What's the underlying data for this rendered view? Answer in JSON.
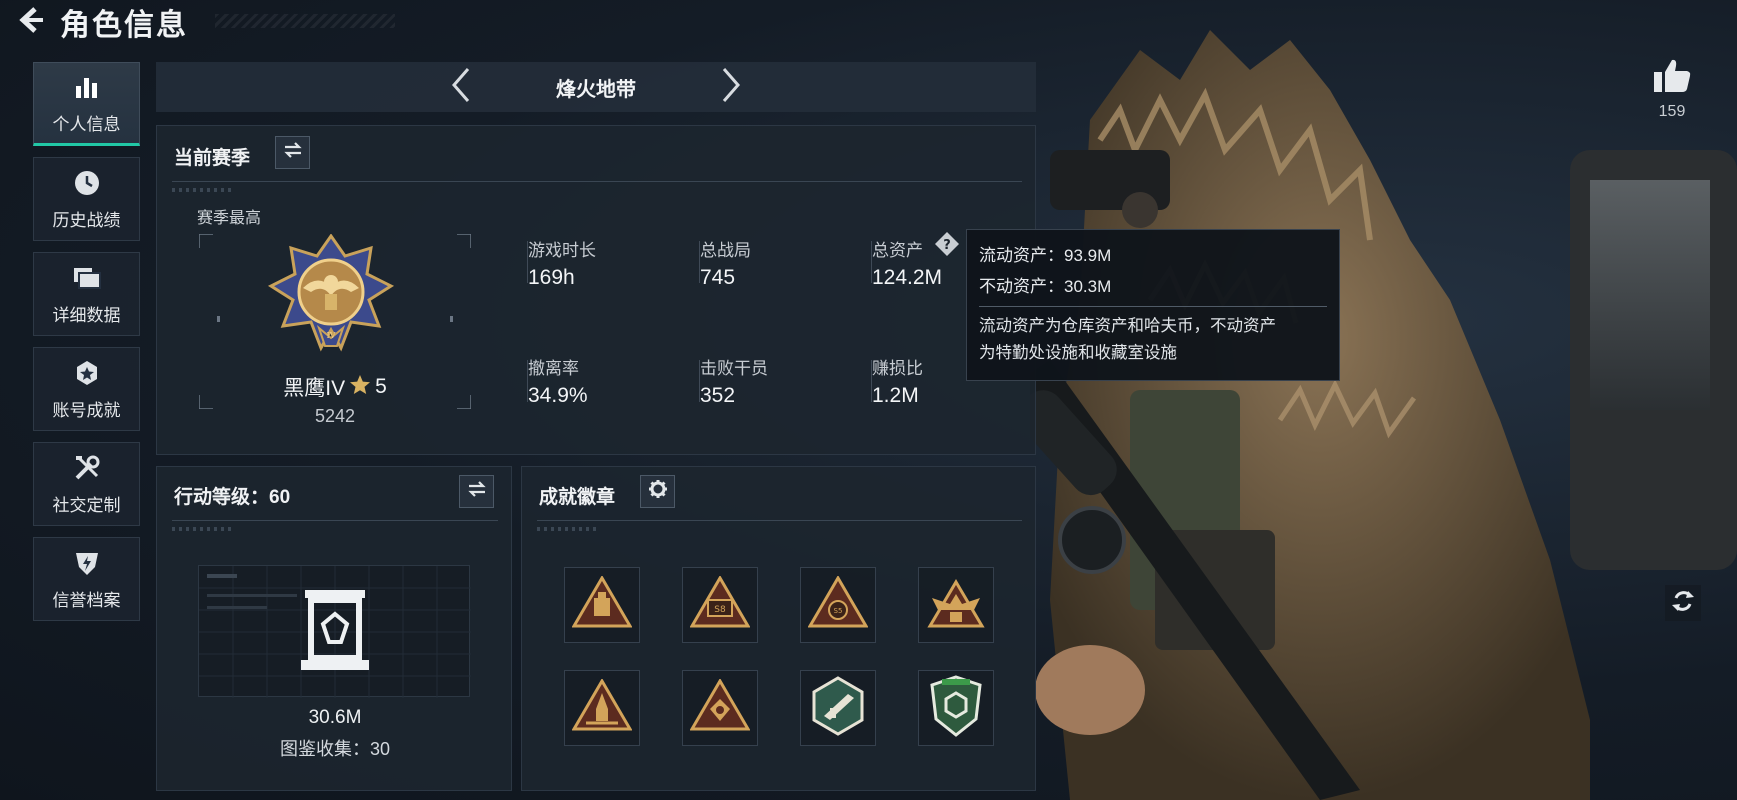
{
  "header": {
    "title": "角色信息"
  },
  "nav": {
    "items": [
      {
        "label": "个人信息",
        "icon": "bar-chart-icon",
        "active": true
      },
      {
        "label": "历史战绩",
        "icon": "clock-icon"
      },
      {
        "label": "详细数据",
        "icon": "folder-icon"
      },
      {
        "label": "账号成就",
        "icon": "star-badge-icon"
      },
      {
        "label": "社交定制",
        "icon": "wrench-screwdriver-icon"
      },
      {
        "label": "信誉档案",
        "icon": "shield-lightning-icon"
      }
    ]
  },
  "season_tab": {
    "name": "烽火地带"
  },
  "current_season": {
    "title": "当前赛季",
    "peak_label": "赛季最高",
    "rank_name": "黑鹰IV",
    "rank_stars": "5",
    "rank_score": "5242",
    "stats": [
      {
        "label": "游戏时长",
        "value": "169h"
      },
      {
        "label": "总战局",
        "value": "745"
      },
      {
        "label": "总资产",
        "value": "124.2M"
      },
      {
        "label": "撤离率",
        "value": "34.9%"
      },
      {
        "label": "击败干员",
        "value": "352"
      },
      {
        "label": "赚损比",
        "value": "1.2M"
      }
    ]
  },
  "tooltip": {
    "liquid": "流动资产：93.9M",
    "fixed": "不动资产：30.3M",
    "desc_line1": "流动资产为仓库资产和哈夫币，不动资产",
    "desc_line2": "为特勤处设施和收藏室设施"
  },
  "action_level": {
    "title": "行动等级：60",
    "value": "30.6M",
    "collection": "图鉴收集：30"
  },
  "achievements": {
    "title": "成就徽章",
    "badges": [
      {
        "icon": "triangle-crate-badge-icon"
      },
      {
        "icon": "triangle-s8-badge-icon"
      },
      {
        "icon": "triangle-s5-badge-icon"
      },
      {
        "icon": "triangle-winged-badge-icon"
      },
      {
        "icon": "triangle-rocket-badge-icon"
      },
      {
        "icon": "triangle-gem-badge-icon"
      },
      {
        "icon": "hexagon-gun-badge-icon"
      },
      {
        "icon": "shield-green-badge-icon"
      }
    ]
  },
  "likes": {
    "count": "159"
  },
  "colors": {
    "accent": "#21c8a6",
    "gold": "#c9a25a",
    "panel": "#1c252f"
  }
}
